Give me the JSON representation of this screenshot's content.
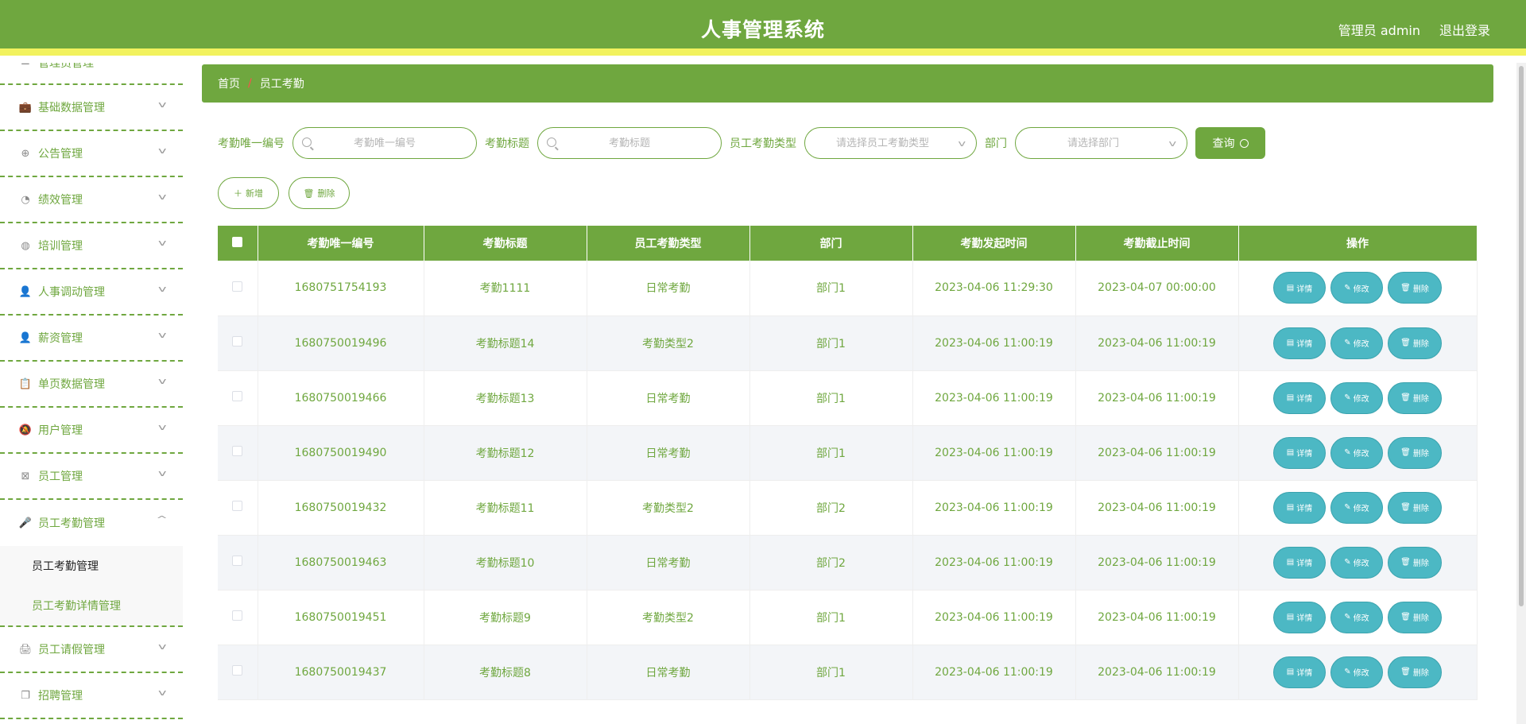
{
  "header": {
    "title": "人事管理系统",
    "user": "管理员 admin",
    "logout": "退出登录",
    "bg_color": "#6fa73f",
    "stripe_color": "#f2f25e"
  },
  "sidebar": {
    "top_item": {
      "label": "管理员管理",
      "icon": "list-icon"
    },
    "items": [
      {
        "label": "基础数据管理",
        "icon": "briefcase-icon"
      },
      {
        "label": "公告管理",
        "icon": "compass-icon"
      },
      {
        "label": "绩效管理",
        "icon": "gauge-icon"
      },
      {
        "label": "培训管理",
        "icon": "speedometer-icon"
      },
      {
        "label": "人事调动管理",
        "icon": "user-icon"
      },
      {
        "label": "薪资管理",
        "icon": "user-filled-icon"
      },
      {
        "label": "单页数据管理",
        "icon": "clipboard-icon"
      },
      {
        "label": "用户管理",
        "icon": "bell-off-icon"
      },
      {
        "label": "员工管理",
        "icon": "delete-box-icon"
      },
      {
        "label": "员工考勤管理",
        "icon": "microphone-icon"
      }
    ],
    "submenu": [
      {
        "label": "员工考勤管理",
        "active": true
      },
      {
        "label": "员工考勤详情管理",
        "active": false
      }
    ],
    "after_items": [
      {
        "label": "员工请假管理",
        "icon": "printer-icon"
      },
      {
        "label": "招聘管理",
        "icon": "copy-icon"
      }
    ]
  },
  "breadcrumb": {
    "home": "首页",
    "separator": "/",
    "current": "员工考勤"
  },
  "search": {
    "fields": [
      {
        "label": "考勤唯一编号",
        "placeholder": "考勤唯一编号"
      },
      {
        "label": "考勤标题",
        "placeholder": "考勤标题"
      },
      {
        "label": "员工考勤类型",
        "placeholder": "请选择员工考勤类型"
      },
      {
        "label": "部门",
        "placeholder": "请选择部门"
      }
    ],
    "query_label": "查询"
  },
  "actions": {
    "add_label": "新增",
    "delete_label": "删除"
  },
  "table": {
    "headers": [
      "考勤唯一编号",
      "考勤标题",
      "员工考勤类型",
      "部门",
      "考勤发起时间",
      "考勤截止时间",
      "操作"
    ],
    "op_labels": {
      "detail": "详情",
      "edit": "修改",
      "delete": "删除"
    },
    "rows": [
      {
        "id": "1680751754193",
        "title": "考勤1111",
        "type": "日常考勤",
        "dept": "部门1",
        "start": "2023-04-06 11:29:30",
        "end": "2023-04-07 00:00:00"
      },
      {
        "id": "1680750019496",
        "title": "考勤标题14",
        "type": "考勤类型2",
        "dept": "部门1",
        "start": "2023-04-06 11:00:19",
        "end": "2023-04-06 11:00:19"
      },
      {
        "id": "1680750019466",
        "title": "考勤标题13",
        "type": "日常考勤",
        "dept": "部门1",
        "start": "2023-04-06 11:00:19",
        "end": "2023-04-06 11:00:19"
      },
      {
        "id": "1680750019490",
        "title": "考勤标题12",
        "type": "日常考勤",
        "dept": "部门1",
        "start": "2023-04-06 11:00:19",
        "end": "2023-04-06 11:00:19"
      },
      {
        "id": "1680750019432",
        "title": "考勤标题11",
        "type": "考勤类型2",
        "dept": "部门2",
        "start": "2023-04-06 11:00:19",
        "end": "2023-04-06 11:00:19"
      },
      {
        "id": "1680750019463",
        "title": "考勤标题10",
        "type": "日常考勤",
        "dept": "部门2",
        "start": "2023-04-06 11:00:19",
        "end": "2023-04-06 11:00:19"
      },
      {
        "id": "1680750019451",
        "title": "考勤标题9",
        "type": "考勤类型2",
        "dept": "部门1",
        "start": "2023-04-06 11:00:19",
        "end": "2023-04-06 11:00:19"
      },
      {
        "id": "1680750019437",
        "title": "考勤标题8",
        "type": "日常考勤",
        "dept": "部门1",
        "start": "2023-04-06 11:00:19",
        "end": "2023-04-06 11:00:19"
      }
    ]
  }
}
